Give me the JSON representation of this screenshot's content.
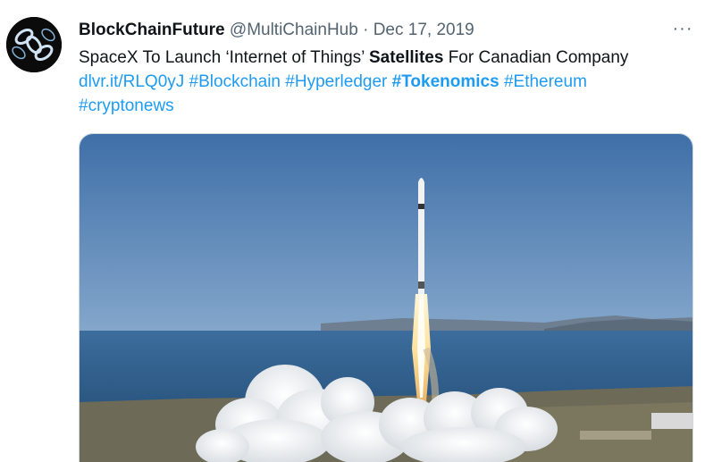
{
  "tweet": {
    "display_name": "BlockChainFuture",
    "handle": "@MultiChainHub",
    "separator": "·",
    "date": "Dec 17, 2019",
    "more_glyph": "···",
    "text": {
      "part1": "SpaceX To Launch ‘Internet of Things’ ",
      "bold": "Satellites",
      "part2": " For Canadian Company"
    },
    "link": "dlvr.it/RLQ0yJ",
    "hashtags": [
      "#Blockchain",
      "#Hyperledger",
      "#Tokenomics",
      "#Ethereum",
      "#cryptonews"
    ],
    "link_color": "#1d9bf0"
  }
}
